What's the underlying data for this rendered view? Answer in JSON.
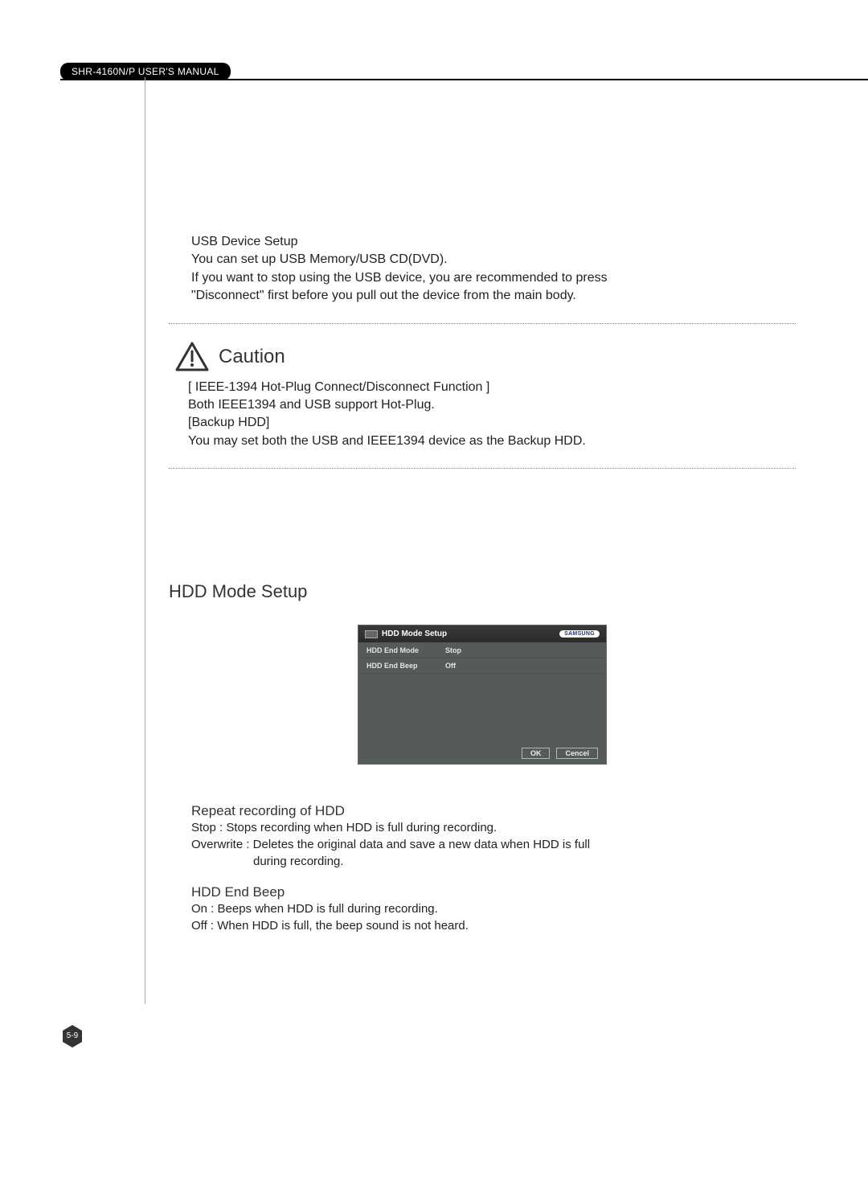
{
  "header": {
    "tab": "SHR-4160N/P USER'S MANUAL"
  },
  "usb": {
    "line1": "USB Device Setup",
    "line2": "You can set up USB Memory/USB CD(DVD).",
    "line3": "If you want to stop using the USB device, you are recommended to press",
    "line4": "\"Disconnect\" first before you pull out the device from the main body."
  },
  "caution": {
    "title": "Caution",
    "line1": "[ IEEE-1394 Hot-Plug Connect/Disconnect Function ]",
    "line2": "Both IEEE1394 and USB support Hot-Plug.",
    "line3": "[Backup HDD]",
    "line4": "You may set both the USB and IEEE1394 device as the Backup HDD."
  },
  "section": {
    "heading": "HDD Mode Setup"
  },
  "osd": {
    "title": "HDD Mode Setup",
    "brand": "SAMSUNG",
    "rows": [
      {
        "label": "HDD End Mode",
        "value": "Stop"
      },
      {
        "label": "HDD End Beep",
        "value": "Off"
      }
    ],
    "ok": "OK",
    "cancel": "Cencel"
  },
  "repeat": {
    "heading": "Repeat recording of HDD",
    "line1": "Stop : Stops recording when HDD is full during recording.",
    "line2a": "Overwrite : Deletes the original data and save a new data when HDD is full",
    "line2b": "during recording."
  },
  "beep": {
    "heading": "HDD End Beep",
    "line1": "On : Beeps when HDD is full during recording.",
    "line2": "Off : When HDD is full, the beep sound is not heard."
  },
  "page_number": "5-9"
}
